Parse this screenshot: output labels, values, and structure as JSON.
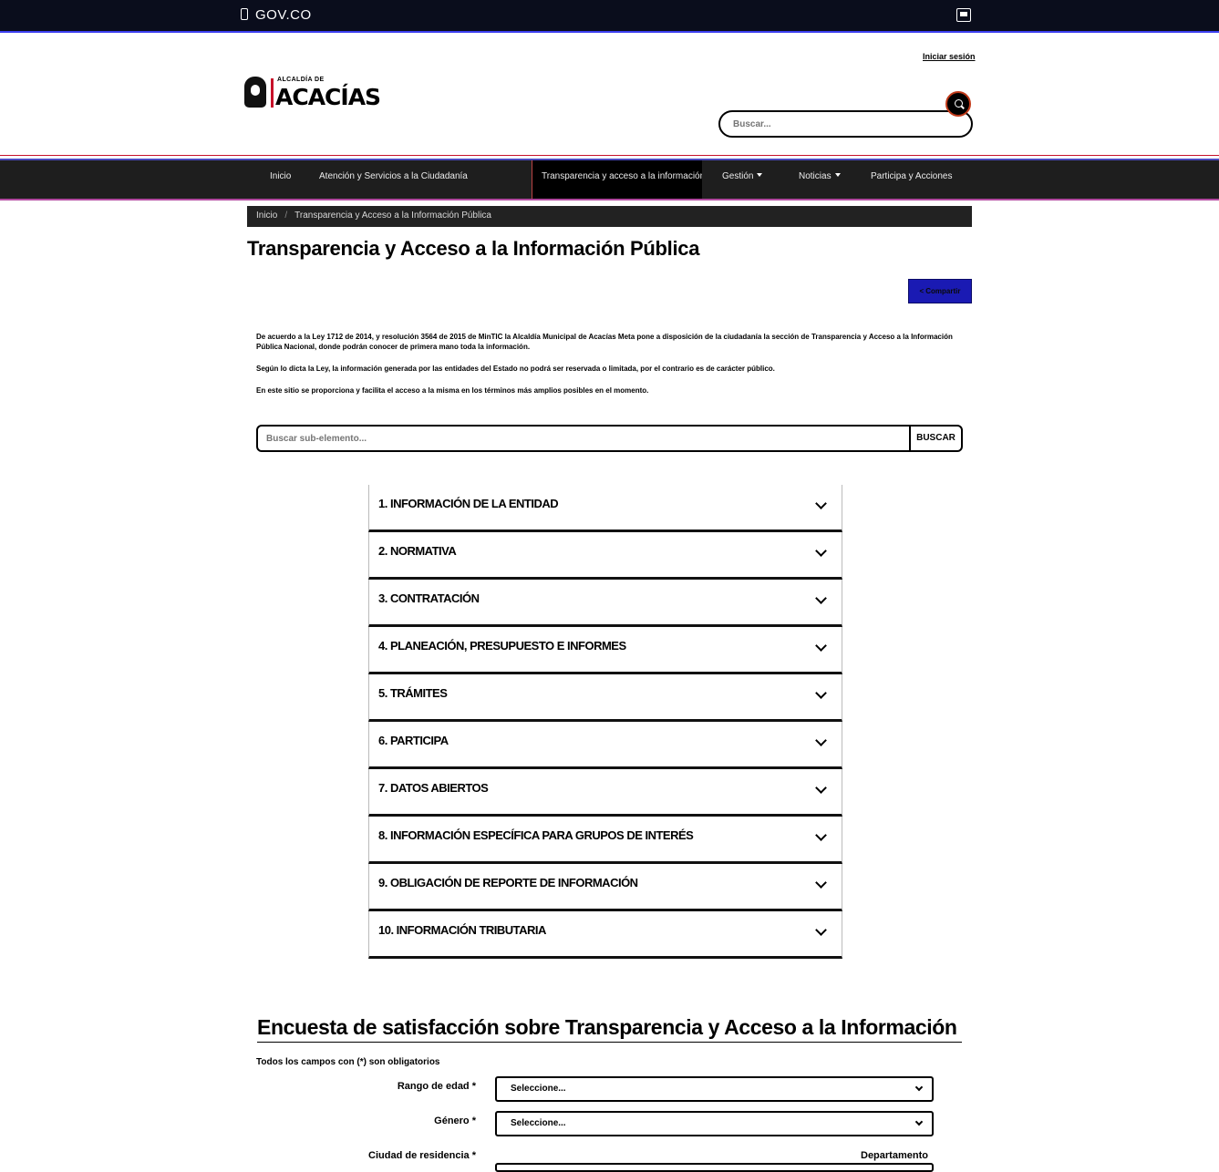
{
  "gov_bar": {
    "brand": "GOV.CO",
    "accessibility_icon": "image-icon"
  },
  "header": {
    "login_link": "Iniciar sesión",
    "logo": {
      "top_text": "ALCALDÍA DE",
      "main_text": "ACACÍAS"
    },
    "search": {
      "placeholder": "Buscar..."
    }
  },
  "nav": {
    "items": [
      {
        "label": "Inicio"
      },
      {
        "label": "Atención y Servicios a la Ciudadanía"
      },
      {
        "label": "Transparencia y acceso a la información",
        "active": true
      },
      {
        "label": "Gestión"
      },
      {
        "label": "Noticias"
      },
      {
        "label": "Participa y Acciones"
      }
    ]
  },
  "breadcrumb": {
    "home": "Inicio",
    "current": "Transparencia y Acceso a la Información Pública"
  },
  "page": {
    "title": "Transparencia y Acceso a la Información Pública",
    "share_label": "Compartir",
    "intro": [
      "De acuerdo a la Ley 1712 de 2014, y resolución 3564 de 2015 de MinTIC la Alcaldía Municipal de Acacías Meta pone a disposición de la ciudadanía la sección de Transparencia y Acceso a la Información Pública Nacional, donde podrán conocer de primera mano toda la información.",
      "Según lo dicta la Ley, la información generada por las entidades del Estado no podrá ser reservada o limitada, por el contrario es de carácter público.",
      "En este sitio se proporciona y facilita el acceso a la misma en los términos más amplios posibles en el momento."
    ],
    "sub_search": {
      "placeholder": "Buscar sub-elemento...",
      "button": "BUSCAR"
    }
  },
  "accordion": [
    "1. INFORMACIÓN DE LA ENTIDAD",
    "2. NORMATIVA",
    "3. CONTRATACIÓN",
    "4. PLANEACIÓN, PRESUPUESTO E INFORMES",
    "5. TRÁMITES",
    "6. PARTICIPA",
    "7. DATOS ABIERTOS",
    "8. INFORMACIÓN ESPECÍFICA PARA GRUPOS DE INTERÉS",
    "9. OBLIGACIÓN DE REPORTE DE INFORMACIÓN",
    "10. INFORMACIÓN TRIBUTARIA"
  ],
  "survey": {
    "title": "Encuesta de satisfacción sobre Transparencia y Acceso a la Información",
    "required_note": "Todos los campos con (*) son obligatorios",
    "fields": {
      "age": {
        "label": "Rango de edad *",
        "value": "Seleccione..."
      },
      "gender": {
        "label": "Género *",
        "value": "Seleccione..."
      },
      "city": {
        "label": "Ciudad de residencia *",
        "sub_label": "Departamento"
      }
    }
  }
}
